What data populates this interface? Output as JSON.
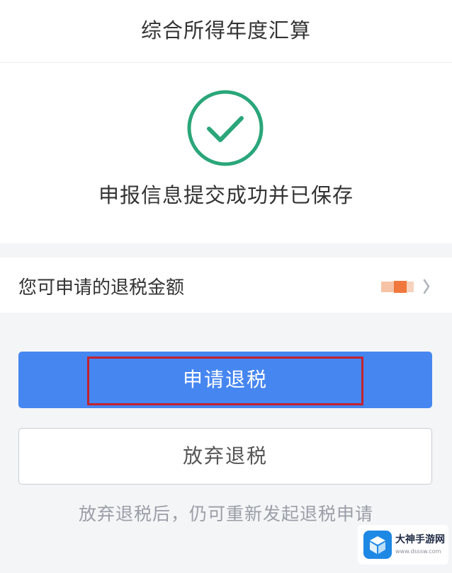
{
  "header": {
    "title": "综合所得年度汇算"
  },
  "result": {
    "icon": "check-circle-icon",
    "message": "申报信息提交成功并已保存"
  },
  "refund": {
    "label": "您可申请的退税金额",
    "amount_state": "redacted"
  },
  "actions": {
    "apply_label": "申请退税",
    "abandon_label": "放弃退税"
  },
  "footer": {
    "hint": "放弃退税后，仍可重新发起退税申请"
  },
  "watermark": {
    "name": "大神手游网",
    "url": "www.dsssw.com"
  },
  "colors": {
    "accent": "#4686f0",
    "success": "#2aa67a",
    "highlight": "#c3222e"
  }
}
